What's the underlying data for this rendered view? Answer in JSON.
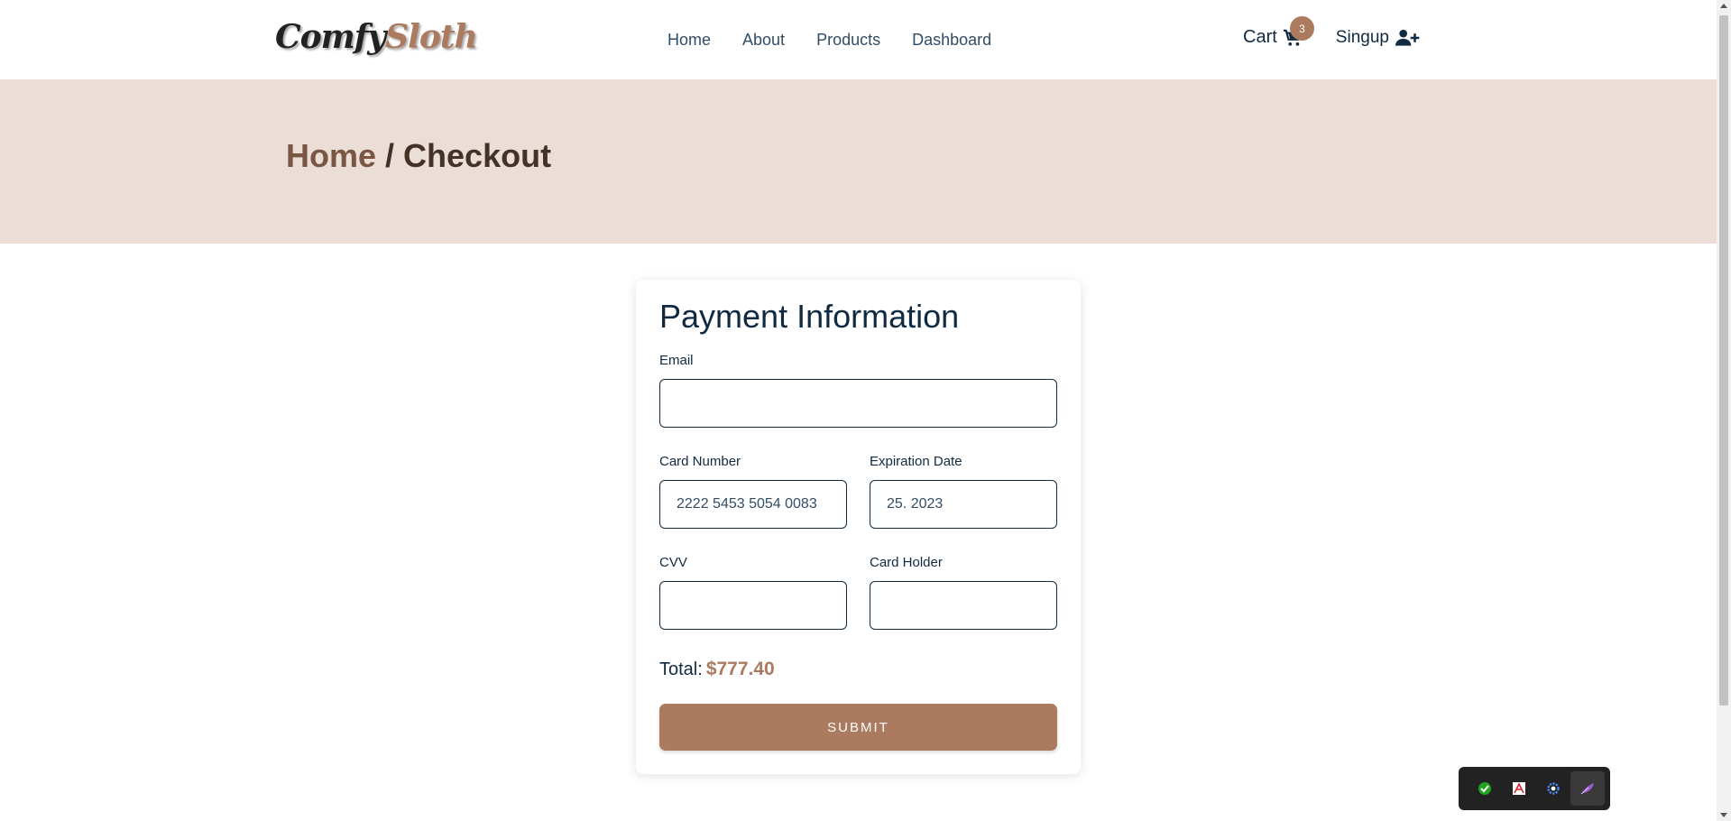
{
  "brand": {
    "part1": "Comfy",
    "part2": "Sloth",
    "accent": "#ab7a5f",
    "dark": "#102a42"
  },
  "nav": {
    "links": [
      "Home",
      "About",
      "Products",
      "Dashboard"
    ]
  },
  "header_actions": {
    "cart_label": "Cart",
    "cart_count": "3",
    "signup_label": "Singup"
  },
  "hero": {
    "crumb_home": "Home",
    "separator": " / ",
    "crumb_current": "Checkout",
    "background": "#eaded7"
  },
  "form": {
    "title": "Payment Information",
    "email": {
      "label": "Email",
      "value": ""
    },
    "card_number": {
      "label": "Card Number",
      "value": "2222 5453 5054 0083"
    },
    "expiration": {
      "label": "Expiration Date",
      "value": "25. 2023"
    },
    "cvv": {
      "label": "CVV",
      "value": ""
    },
    "card_holder": {
      "label": "Card Holder",
      "value": ""
    },
    "total_label": "Total:",
    "total_value": "$777.40",
    "submit_label": "SUBMIT"
  },
  "extensions": {
    "icons": [
      "green-extension-icon",
      "pdf-extension-icon",
      "gear-extension-icon",
      "feather-extension-icon"
    ]
  }
}
